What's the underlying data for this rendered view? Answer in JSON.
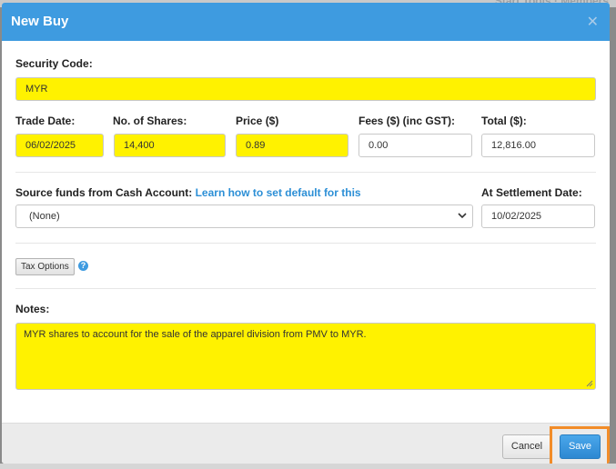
{
  "background": {
    "top_text": "Start Tools  ·  Members"
  },
  "modal": {
    "title": "New Buy",
    "close_icon": "close-icon"
  },
  "form": {
    "security_code": {
      "label": "Security Code:",
      "value": "MYR"
    },
    "trade_date": {
      "label": "Trade Date:",
      "value": "06/02/2025"
    },
    "shares": {
      "label": "No. of Shares:",
      "value": "14,400"
    },
    "price": {
      "label": "Price ($)",
      "value": "0.89"
    },
    "fees": {
      "label": "Fees ($) (inc GST):",
      "value": "0.00"
    },
    "total": {
      "label": "Total ($):",
      "value": "12,816.00"
    },
    "source_funds": {
      "label": "Source funds from Cash Account:",
      "link": "Learn how to set default for this",
      "selected": "(None)"
    },
    "settlement": {
      "label": "At Settlement Date:",
      "value": "10/02/2025"
    },
    "tax_options_label": "Tax Options",
    "notes": {
      "label": "Notes:",
      "value": "MYR shares to account for the sale of the apparel  division from PMV to MYR."
    }
  },
  "footer": {
    "cancel_label": "Cancel",
    "save_label": "Save"
  },
  "colors": {
    "header": "#3e9be0",
    "highlight_fill": "#fff200",
    "save_highlight_border": "#f28c28",
    "link": "#2c8fd6"
  }
}
